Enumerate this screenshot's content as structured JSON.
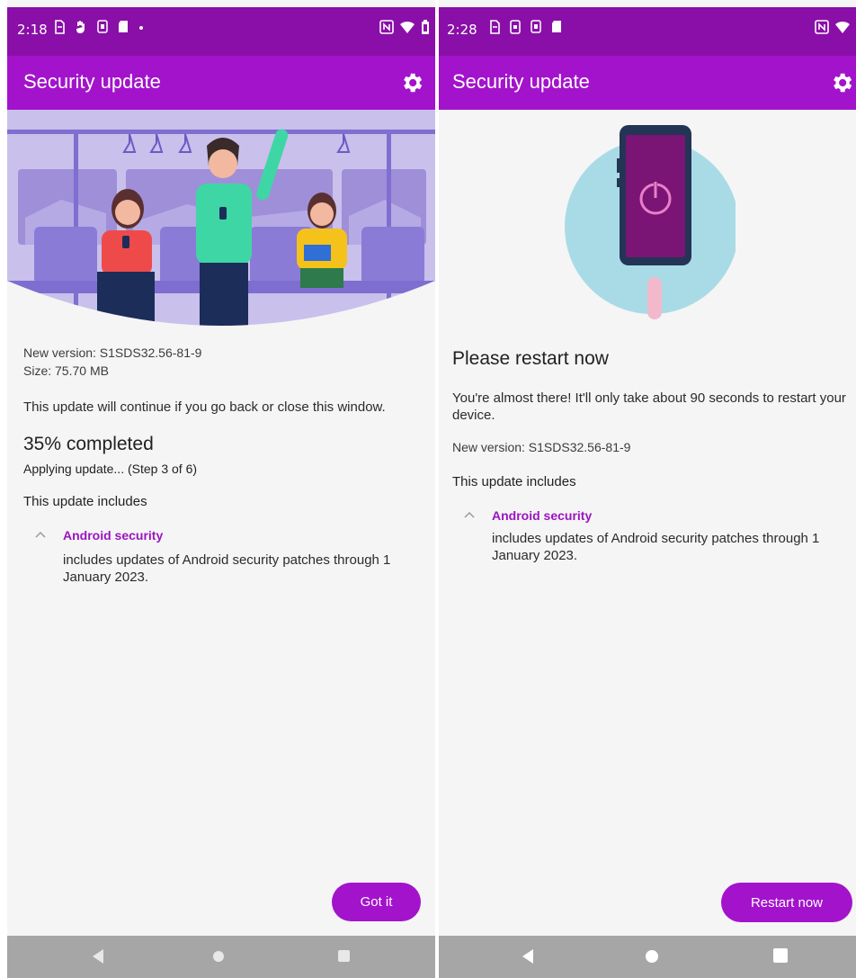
{
  "colors": {
    "status_bar": "#8a0fa8",
    "app_bar": "#a313cc",
    "accent": "#a313cc",
    "link_purple": "#9b14c0",
    "background": "#f5f5f5",
    "nav_bar": "#a6a6a6"
  },
  "left_screen": {
    "status_bar": {
      "time": "2:18",
      "notification_icons": [
        "sim-icon",
        "hand-icon",
        "sim-card-icon",
        "sd-card-icon",
        "dot-icon"
      ],
      "system_icons": [
        "nfc-icon",
        "wifi-icon",
        "battery-icon"
      ]
    },
    "app_bar": {
      "title": "Security update",
      "settings_icon": "gear-icon"
    },
    "illustration": "commuters-on-train-illustration",
    "version_line": "New version: S1SDS32.56-81-9",
    "size_line": "Size: 75.70 MB",
    "notice": "This update will continue if you go back or close this window.",
    "progress": {
      "value_percent": 35,
      "label": "35% completed",
      "step_text": "Applying update... (Step 3 of 6)"
    },
    "includes_heading": "This update includes",
    "item": {
      "title": "Android security",
      "description": "includes updates of Android security patches through 1 January 2023.",
      "expanded": true
    },
    "button_label": "Got it",
    "nav": [
      "back-icon",
      "home-icon",
      "recents-icon"
    ]
  },
  "right_screen": {
    "status_bar": {
      "time": "2:28",
      "notification_icons": [
        "sim-icon",
        "phone-icon",
        "sim-card-icon",
        "sd-card-icon"
      ],
      "system_icons": [
        "nfc-icon",
        "wifi-icon",
        "battery-icon"
      ]
    },
    "app_bar": {
      "title": "Security update",
      "settings_icon": "gear-icon"
    },
    "illustration": "phone-power-illustration",
    "heading": "Please restart now",
    "message": "You're almost there! It'll only take about 90 seconds to restart your device.",
    "version_line": "New version: S1SDS32.56-81-9",
    "includes_heading": "This update includes",
    "item": {
      "title": "Android security",
      "description": "includes updates of Android security patches through 1 January 2023.",
      "expanded": true
    },
    "button_label": "Restart now",
    "nav": [
      "back-icon",
      "home-icon",
      "recents-icon"
    ]
  }
}
